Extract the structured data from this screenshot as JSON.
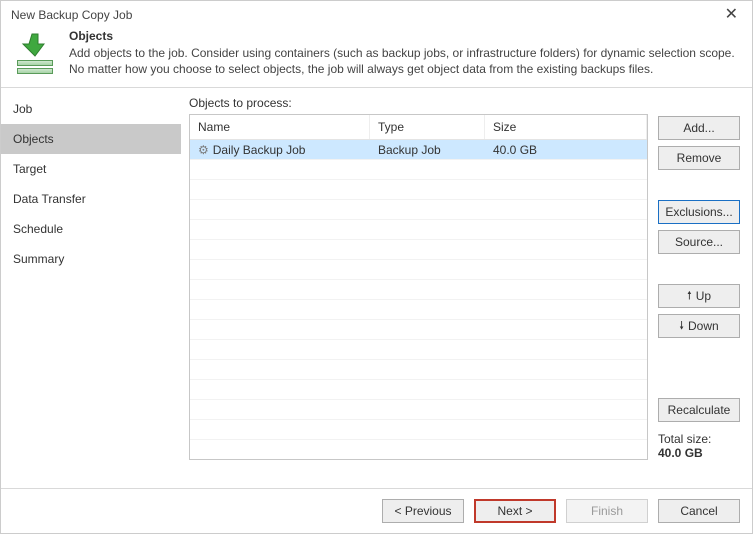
{
  "window": {
    "title": "New Backup Copy Job"
  },
  "header": {
    "heading": "Objects",
    "description": "Add objects to the job. Consider using containers (such as backup jobs, or infrastructure folders) for dynamic selection scope. No matter how you choose to select objects, the job will always get object data from the existing backups files."
  },
  "sidebar": {
    "items": [
      {
        "label": "Job"
      },
      {
        "label": "Objects"
      },
      {
        "label": "Target"
      },
      {
        "label": "Data Transfer"
      },
      {
        "label": "Schedule"
      },
      {
        "label": "Summary"
      }
    ],
    "active_index": 1
  },
  "main": {
    "objects_label": "Objects to process:",
    "columns": {
      "name": "Name",
      "type": "Type",
      "size": "Size"
    },
    "rows": [
      {
        "icon": "gear-icon",
        "name": "Daily Backup Job",
        "type": "Backup Job",
        "size": "40.0 GB",
        "selected": true
      }
    ],
    "empty_row_count": 17,
    "buttons": {
      "add": "Add...",
      "remove": "Remove",
      "exclusions": "Exclusions...",
      "source": "Source...",
      "up": "Up",
      "down": "Down",
      "recalculate": "Recalculate"
    },
    "totals": {
      "label": "Total size:",
      "value": "40.0 GB"
    }
  },
  "footer": {
    "previous": "< Previous",
    "next": "Next >",
    "finish": "Finish",
    "cancel": "Cancel"
  }
}
